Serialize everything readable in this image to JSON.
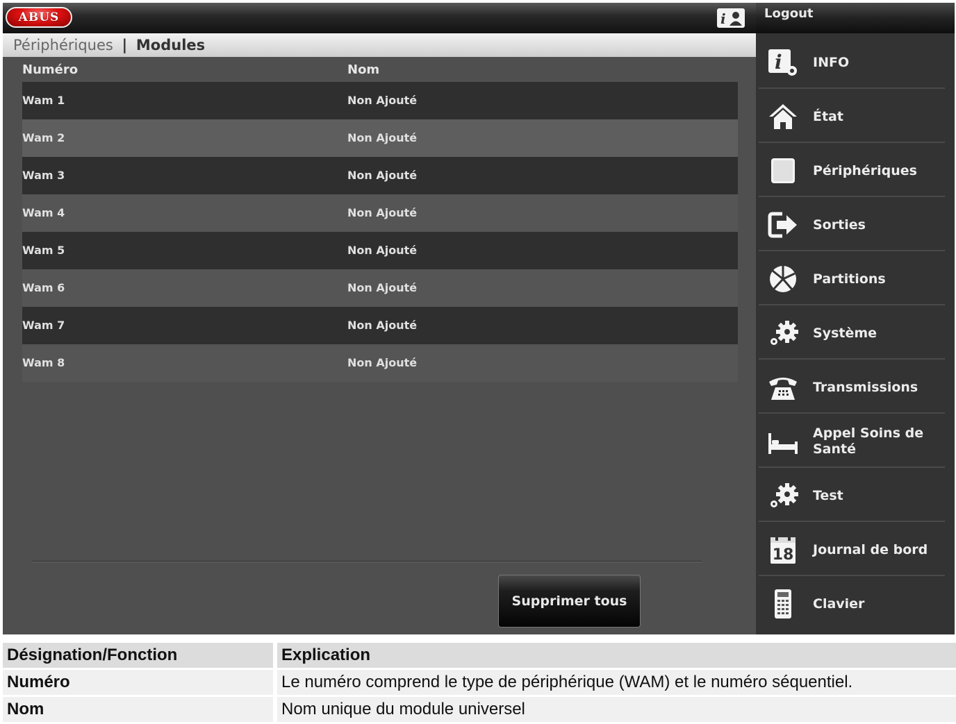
{
  "header": {
    "logo_text": "ABUS",
    "help_icon": "info-user-icon",
    "logout_label": "Logout"
  },
  "breadcrumb": {
    "parent": "Périphériques",
    "separator": "|",
    "current": "Modules"
  },
  "table": {
    "columns": [
      "Numéro",
      "Nom"
    ],
    "rows": [
      {
        "numero": "Wam 1",
        "nom": "Non Ajouté"
      },
      {
        "numero": "Wam 2",
        "nom": "Non Ajouté"
      },
      {
        "numero": "Wam 3",
        "nom": "Non Ajouté"
      },
      {
        "numero": "Wam 4",
        "nom": "Non Ajouté"
      },
      {
        "numero": "Wam 5",
        "nom": "Non Ajouté"
      },
      {
        "numero": "Wam 6",
        "nom": "Non Ajouté"
      },
      {
        "numero": "Wam 7",
        "nom": "Non Ajouté"
      },
      {
        "numero": "Wam 8",
        "nom": "Non Ajouté"
      }
    ],
    "delete_all_label": "Supprimer tous"
  },
  "sidebar": {
    "items": [
      {
        "label": "INFO",
        "icon": "info-settings-icon"
      },
      {
        "label": "État",
        "icon": "home-icon"
      },
      {
        "label": "Périphériques",
        "icon": "device-icon"
      },
      {
        "label": "Sorties",
        "icon": "exit-icon"
      },
      {
        "label": "Partitions",
        "icon": "partitions-icon"
      },
      {
        "label": "Système",
        "icon": "gears-icon"
      },
      {
        "label": "Transmissions",
        "icon": "telephone-icon"
      },
      {
        "label": "Appel Soins de Santé",
        "icon": "bed-icon"
      },
      {
        "label": "Test",
        "icon": "gears-icon"
      },
      {
        "label": "Journal de bord",
        "icon": "calendar-icon"
      },
      {
        "label": "Clavier",
        "icon": "keypad-icon"
      }
    ],
    "calendar_day": "18"
  },
  "legend": {
    "headers": [
      "Désignation/Fonction",
      "Explication"
    ],
    "rows": [
      {
        "term": "Numéro",
        "explanation": "Le numéro comprend le type de périphérique (WAM) et le numéro séquentiel."
      },
      {
        "term": "Nom",
        "explanation": "Nom unique du module universel"
      }
    ]
  },
  "colors": {
    "brand_red": "#d11111",
    "panel_dark": "#333333",
    "content_gray": "#4f4f4f"
  }
}
